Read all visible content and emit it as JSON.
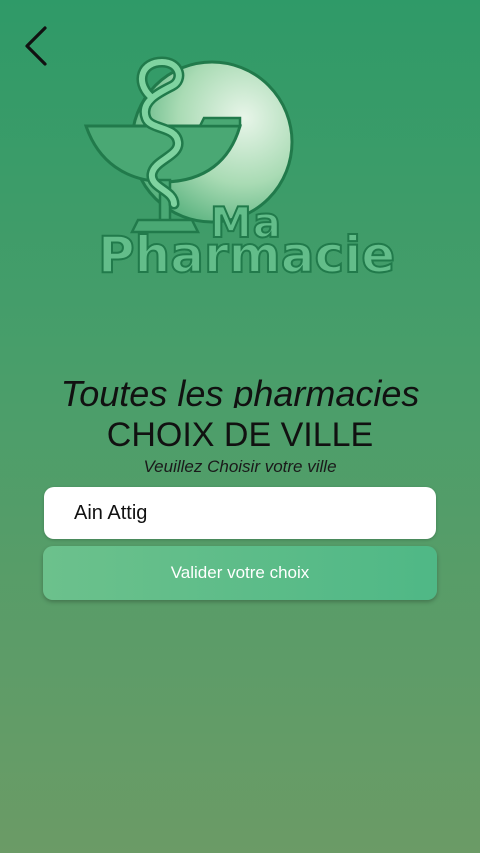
{
  "logo": {
    "ma": "Ma",
    "pharmacie": "Pharmacie"
  },
  "header": {
    "slogan": "Toutes les pharmacies",
    "title": "CHOIX DE VILLE",
    "subtitle": "Veuillez Choisir votre ville"
  },
  "form": {
    "city_value": "Ain Attig",
    "validate_label": "Valider votre choix"
  },
  "colors": {
    "background_top": "#2f9a68",
    "background_bottom": "#6b9b66",
    "button": "#5bbd89",
    "logo_fill": "#63bd8a",
    "logo_stroke": "#217a4b"
  },
  "icons": {
    "back": "chevron-left-icon",
    "logo": "pharmacy-caduceus-icon"
  }
}
